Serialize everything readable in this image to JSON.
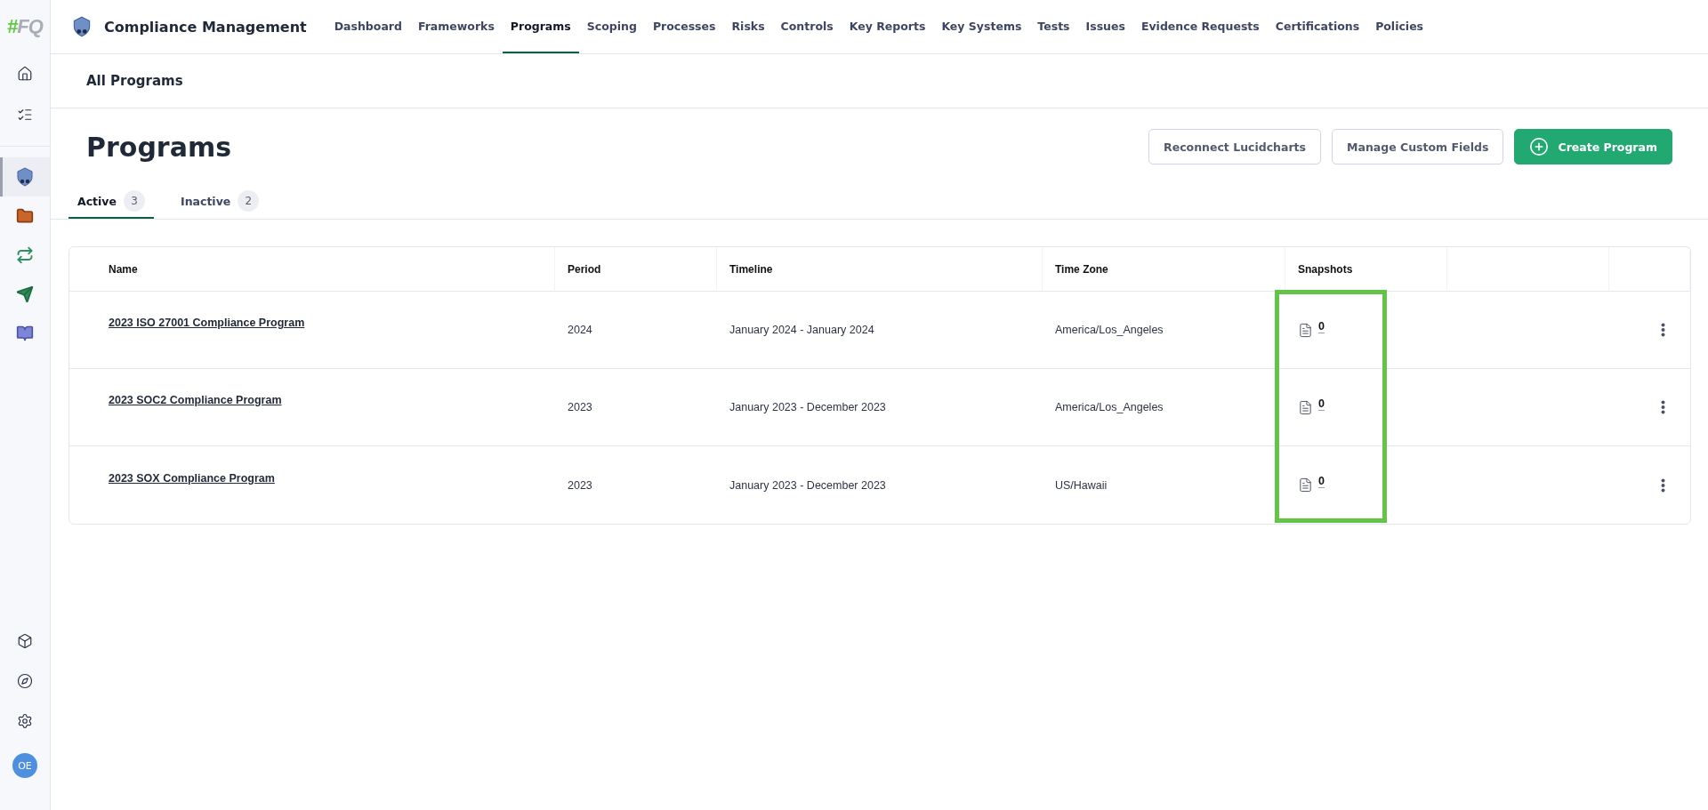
{
  "sidebar": {
    "logo": {
      "mark": "#",
      "name": "FQ"
    },
    "top_items": [
      {
        "kind": "home",
        "selected": false
      },
      {
        "kind": "tasks",
        "selected": false
      }
    ],
    "app_items": [
      {
        "kind": "shield",
        "selected": true
      },
      {
        "kind": "folder",
        "selected": false
      },
      {
        "kind": "sync",
        "selected": false
      },
      {
        "kind": "send",
        "selected": false
      },
      {
        "kind": "book",
        "selected": false
      }
    ],
    "bottom_items": [
      {
        "kind": "cube",
        "selected": false
      },
      {
        "kind": "compass",
        "selected": false
      },
      {
        "kind": "settings",
        "selected": false
      }
    ],
    "avatar": "OE"
  },
  "header": {
    "title": "Compliance Management",
    "nav": [
      {
        "label": "Dashboard",
        "selected": false
      },
      {
        "label": "Frameworks",
        "selected": false
      },
      {
        "label": "Programs",
        "selected": true
      },
      {
        "label": "Scoping",
        "selected": false
      },
      {
        "label": "Processes",
        "selected": false
      },
      {
        "label": "Risks",
        "selected": false
      },
      {
        "label": "Controls",
        "selected": false
      },
      {
        "label": "Key Reports",
        "selected": false
      },
      {
        "label": "Key Systems",
        "selected": false
      },
      {
        "label": "Tests",
        "selected": false
      },
      {
        "label": "Issues",
        "selected": false
      },
      {
        "label": "Evidence Requests",
        "selected": false
      },
      {
        "label": "Certifications",
        "selected": false
      },
      {
        "label": "Policies",
        "selected": false
      }
    ]
  },
  "breadcrumb": "All Programs",
  "page_title": "Programs",
  "actions": [
    {
      "label": "Reconnect Lucidcharts",
      "kind": "outline"
    },
    {
      "label": "Manage Custom Fields",
      "kind": "outline"
    },
    {
      "label": "Create Program",
      "kind": "primary"
    }
  ],
  "tabs": [
    {
      "label": "Active",
      "count": "3",
      "selected": true
    },
    {
      "label": "Inactive",
      "count": "2",
      "selected": false
    }
  ],
  "table": {
    "columns": [
      "Name",
      "Period",
      "Timeline",
      "Time Zone",
      "Snapshots"
    ],
    "rows": [
      {
        "name": "2023 ISO 27001 Compliance Program",
        "period": "2024",
        "timeline": "January 2024 - January 2024",
        "time_zone": "America/Los_Angeles",
        "snapshots": "0"
      },
      {
        "name": "2023 SOC2 Compliance Program",
        "period": "2023",
        "timeline": "January 2023 - December 2023",
        "time_zone": "America/Los_Angeles",
        "snapshots": "0"
      },
      {
        "name": "2023 SOX Compliance Program",
        "period": "2023",
        "timeline": "January 2023 - December 2023",
        "time_zone": "US/Hawaii",
        "snapshots": "0"
      }
    ]
  }
}
